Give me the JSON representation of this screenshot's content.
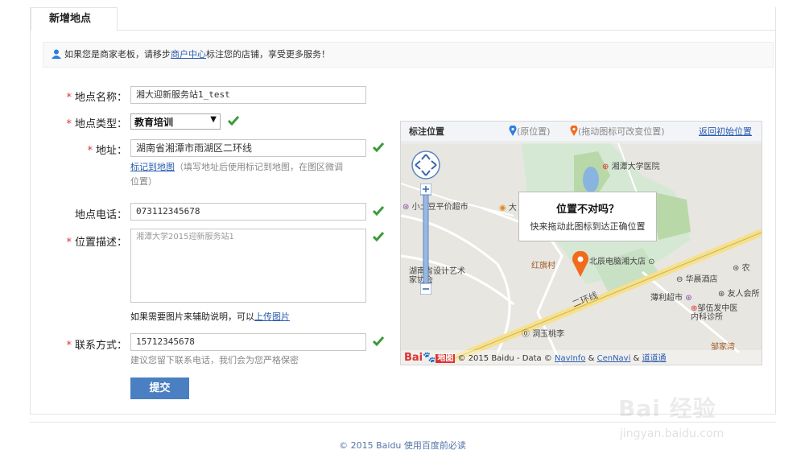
{
  "tab": {
    "label": "新增地点"
  },
  "tip": {
    "prefix": "如果您是商家老板，请移步",
    "link": "商户中心",
    "suffix": "标注您的店铺，享受更多服务！"
  },
  "form": {
    "name": {
      "label": "地点名称：",
      "value": "湘大迎新服务站1_test"
    },
    "type": {
      "label": "地点类型：",
      "value": "教育培训"
    },
    "address": {
      "label": "地址：",
      "value": "湖南省湘潭市雨湖区二环线",
      "helper_link": "标记到地图",
      "helper_text": "（填写地址后使用标记到地图，在图区微调位置）"
    },
    "phone": {
      "label": "地点电话：",
      "value": "073112345678"
    },
    "desc": {
      "label": "位置描述：",
      "value": "湘潭大学2015迎新服务站1",
      "note_prefix": "如果需要图片来辅助说明，可以",
      "note_link": "上传图片"
    },
    "contact": {
      "label": "联系方式：",
      "value": "15712345678",
      "helper": "建议您留下联系电话，我们会为您严格保密"
    },
    "required_mark": "*",
    "submit_label": "提交"
  },
  "map": {
    "title": "标注位置",
    "legend_original": "(原位置)",
    "legend_drag": "(拖动图标可改变位置)",
    "reset_label": "返回初始位置",
    "popup_title": "位置不对吗？",
    "popup_sub": "快来拖动此图标到达正确位置",
    "labels": {
      "hospital": "湘潭大学医院",
      "supermarket": "小土豆平价超市",
      "da": "大",
      "hongqi": "红旗村",
      "store": "北辰电脑湘大店",
      "nong": "农",
      "design": "湖南省设计艺术家协会",
      "hotel": "华晨酒店",
      "youren": "友人会所",
      "erhuan": "二环线",
      "boli": "薄利超市",
      "clinic": "邹伍发中医内科诊所",
      "dongyu": "洞玉桃李",
      "zoujiawan": "邹家湾"
    },
    "logo_bai": "Bai",
    "logo_du": "地图",
    "copyright_text": "© 2015 Baidu - Data © ",
    "navinfo": "NavInfo",
    "amp": " & ",
    "cennavi": "CenNavi",
    "amp2": " & ",
    "daodaotong": "道道通"
  },
  "footer": {
    "text": "© 2015 Baidu 使用百度前必读"
  },
  "watermark": {
    "main": "Bai 经验",
    "sub": "jingyan.baidu.com"
  },
  "colors": {
    "link": "#2a5db0",
    "submit": "#4a7fc1",
    "check": "#3a9a3a",
    "required": "#d33333",
    "pin": "#f26a1b",
    "pin_orig": "#2a7fe0"
  }
}
